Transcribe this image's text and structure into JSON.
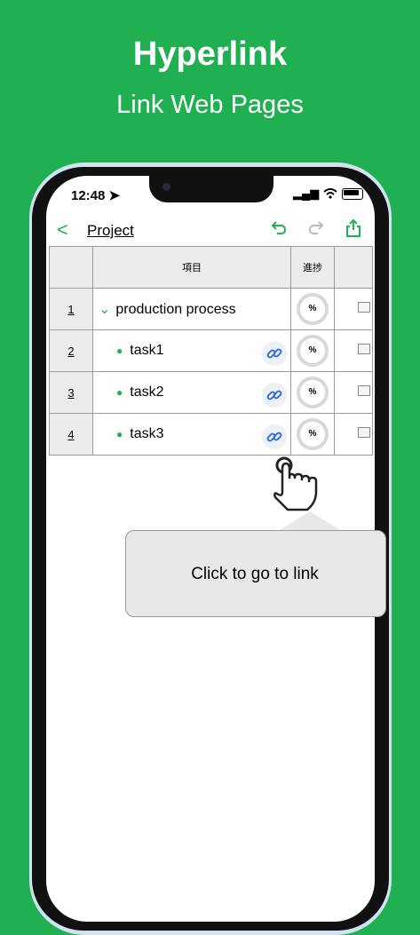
{
  "banner": {
    "title": "Hyperlink",
    "subtitle": "Link Web Pages"
  },
  "status": {
    "time": "12:48"
  },
  "nav": {
    "title": "Project"
  },
  "table": {
    "headers": {
      "item": "項目",
      "progress": "進捗"
    },
    "rows": [
      {
        "num": "1",
        "label": "production process",
        "progress": "%"
      },
      {
        "num": "2",
        "label": "task1",
        "progress": "%"
      },
      {
        "num": "3",
        "label": "task2",
        "progress": "%"
      },
      {
        "num": "4",
        "label": "task3",
        "progress": "%"
      }
    ]
  },
  "tooltip": {
    "text": "Click to go to link"
  },
  "colors": {
    "accent": "#20b052",
    "link": "#2f6fd8"
  }
}
